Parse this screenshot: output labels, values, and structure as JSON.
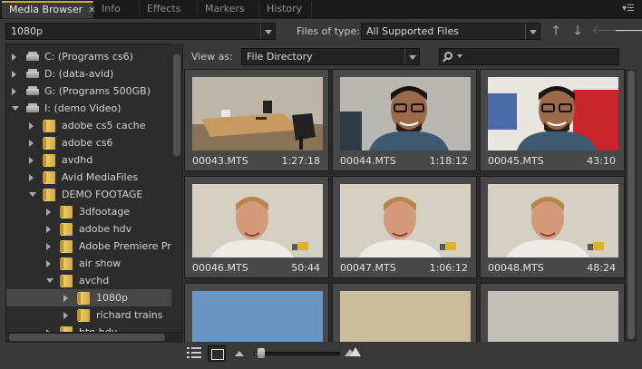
{
  "tabs": [
    {
      "label": "Media Browser",
      "active": true,
      "closable": true
    },
    {
      "label": "Info",
      "active": false
    },
    {
      "label": "Effects",
      "active": false
    },
    {
      "label": "Markers",
      "active": false
    },
    {
      "label": "History",
      "active": false
    }
  ],
  "panel_menu_icon": "panel-menu-icon",
  "path_dropdown": {
    "value": "1080p"
  },
  "files_of_type": {
    "label": "Files of type:",
    "value": "All Supported Files"
  },
  "navigation": {
    "up": "up-arrow-icon",
    "down": "down-arrow-icon",
    "back": "back-arrow-icon",
    "forward": "forward-arrow-icon"
  },
  "view_as": {
    "label": "View as:",
    "value": "File Directory"
  },
  "search": {
    "placeholder": ""
  },
  "tree": [
    {
      "label": "C: (Programs cs6)",
      "type": "drive",
      "depth": 0,
      "expanded": false
    },
    {
      "label": "D: (data-avid)",
      "type": "drive",
      "depth": 0,
      "expanded": false
    },
    {
      "label": "G: (Programs 500GB)",
      "type": "drive",
      "depth": 0,
      "expanded": false
    },
    {
      "label": "I: (demo Video)",
      "type": "drive",
      "depth": 0,
      "expanded": true
    },
    {
      "label": "adobe cs5 cache",
      "type": "folder",
      "depth": 1,
      "expanded": false
    },
    {
      "label": "adobe cs6",
      "type": "folder",
      "depth": 1,
      "expanded": false
    },
    {
      "label": "avdhd",
      "type": "folder",
      "depth": 1,
      "expanded": false
    },
    {
      "label": "Avid MediaFiles",
      "type": "folder",
      "depth": 1,
      "expanded": false
    },
    {
      "label": "DEMO FOOTAGE",
      "type": "folder",
      "depth": 1,
      "expanded": true
    },
    {
      "label": "3dfootage",
      "type": "folder",
      "depth": 2,
      "expanded": false
    },
    {
      "label": "adobe hdv",
      "type": "folder",
      "depth": 2,
      "expanded": false
    },
    {
      "label": "Adobe Premiere Pro",
      "type": "folder",
      "depth": 2,
      "expanded": false
    },
    {
      "label": "air show",
      "type": "folder",
      "depth": 2,
      "expanded": false
    },
    {
      "label": "avchd",
      "type": "folder",
      "depth": 2,
      "expanded": true
    },
    {
      "label": "1080p",
      "type": "folder",
      "depth": 3,
      "expanded": false,
      "selected": true
    },
    {
      "label": "richard trains",
      "type": "folder",
      "depth": 3,
      "expanded": false
    },
    {
      "label": "btn hdv",
      "type": "folder",
      "depth": 2,
      "expanded": false
    }
  ],
  "clips": [
    {
      "name": "00043.MTS",
      "duration": "1:27:18",
      "thumb": "office"
    },
    {
      "name": "00044.MTS",
      "duration": "1:18:12",
      "thumb": "man-glasses"
    },
    {
      "name": "00045.MTS",
      "duration": "43:10",
      "thumb": "man-glasses-bright"
    },
    {
      "name": "00046.MTS",
      "duration": "50:44",
      "thumb": "man-blond"
    },
    {
      "name": "00047.MTS",
      "duration": "1:06:12",
      "thumb": "man-blond"
    },
    {
      "name": "00048.MTS",
      "duration": "48:24",
      "thumb": "man-blond"
    },
    {
      "name": "",
      "duration": "",
      "thumb": "blue"
    },
    {
      "name": "",
      "duration": "",
      "thumb": "beige"
    },
    {
      "name": "",
      "duration": "",
      "thumb": "grey"
    }
  ],
  "bottom": {
    "list_view_icon": "list-view-icon",
    "icon_view_icon": "icon-view-icon",
    "zoom_level": 0.05
  },
  "colors": {
    "accent": "#d9a62e",
    "panel": "#393939",
    "folder": "#e8c25a"
  }
}
